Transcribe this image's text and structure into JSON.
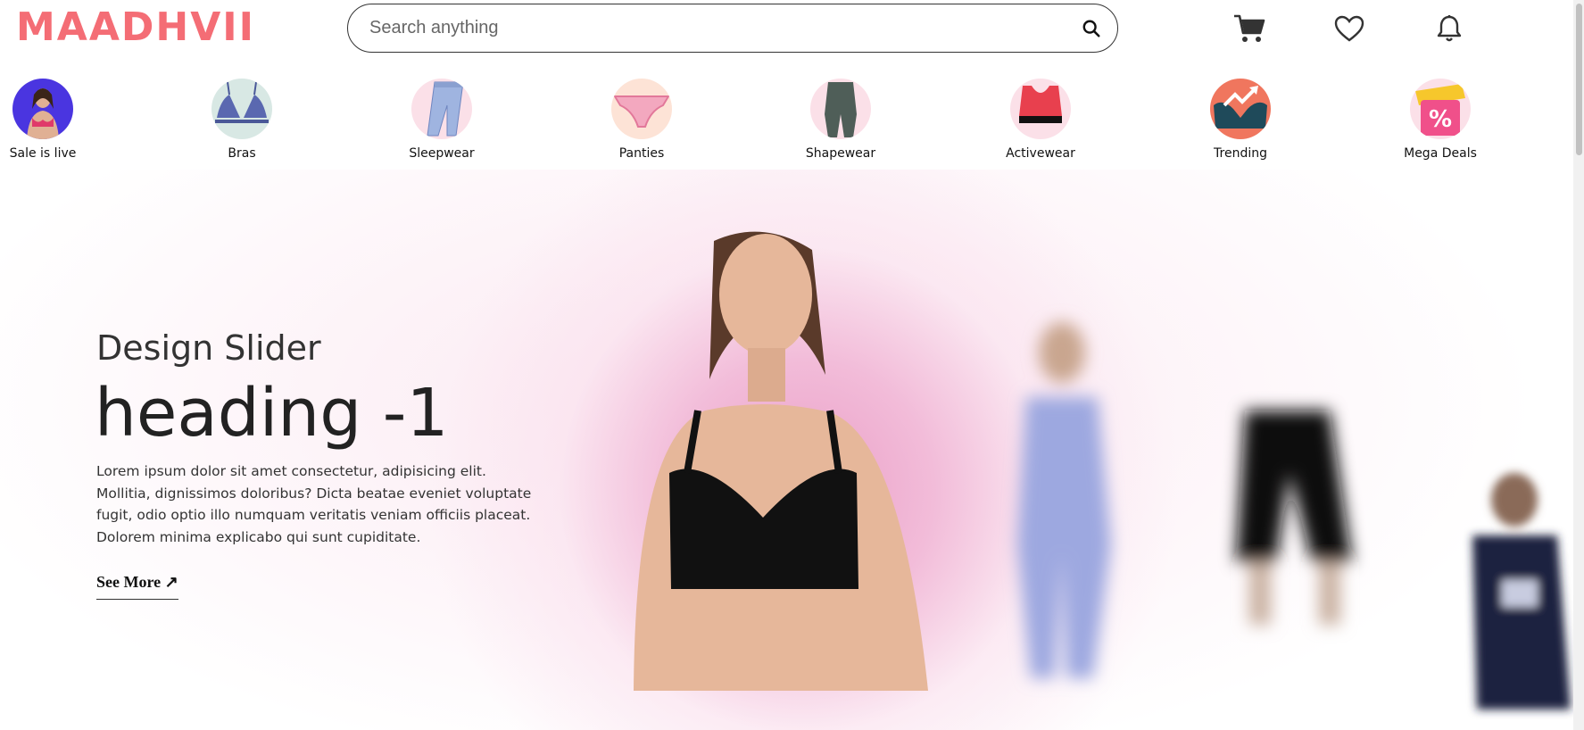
{
  "header": {
    "logo": "MAADHVII",
    "search_placeholder": "Search anything"
  },
  "categories": [
    {
      "label": "Sale is live",
      "icon": "model-photo-icon",
      "bg": "#4a35e0"
    },
    {
      "label": "Bras",
      "icon": "bra-icon",
      "bg": "#d8e8e4"
    },
    {
      "label": "Sleepwear",
      "icon": "pajama-icon",
      "bg": "#fbe0e8"
    },
    {
      "label": "Panties",
      "icon": "panty-icon",
      "bg": "#fde3d6"
    },
    {
      "label": "Shapewear",
      "icon": "shapewear-icon",
      "bg": "#fbe0e8"
    },
    {
      "label": "Activewear",
      "icon": "sports-bra-icon",
      "bg": "#fbe0e8"
    },
    {
      "label": "Trending",
      "icon": "trending-icon",
      "bg": "#f0765e"
    },
    {
      "label": "Mega Deals",
      "icon": "discount-tag-icon",
      "bg": "#fbe0e8"
    }
  ],
  "hero": {
    "subtitle": "Design Slider",
    "title": "heading -1",
    "description": "Lorem ipsum dolor sit amet consectetur, adipisicing elit. Mollitia, dignissimos doloribus? Dicta beatae eveniet voluptate fugit, odio optio illo numquam veritatis veniam officiis placeat. Dolorem minima explicabo qui sunt cupiditate.",
    "cta": "See More ↗"
  },
  "colors": {
    "brand": "#f46d75",
    "hero_pink": "#ea9ec6"
  }
}
